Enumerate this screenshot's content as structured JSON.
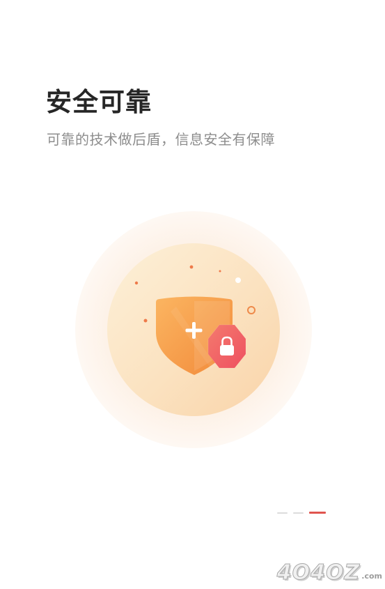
{
  "page": {
    "title": "安全可靠",
    "subtitle": "可靠的技术做后盾，信息安全有保障"
  },
  "illustration": {
    "icons": [
      "shield-icon",
      "plus-icon",
      "lock-icon"
    ],
    "colors": {
      "outer_halo": "#fdf3ea",
      "inner_circle": "#fbe0bf",
      "shield": "#f59a49",
      "badge": "#f26a6a"
    }
  },
  "pager": {
    "total": 3,
    "current": 3,
    "colors": {
      "active": "#e0554f",
      "inactive": "#dcdcdc"
    }
  },
  "watermark": {
    "brand": "4O4OZ",
    "suffix": ".com"
  }
}
